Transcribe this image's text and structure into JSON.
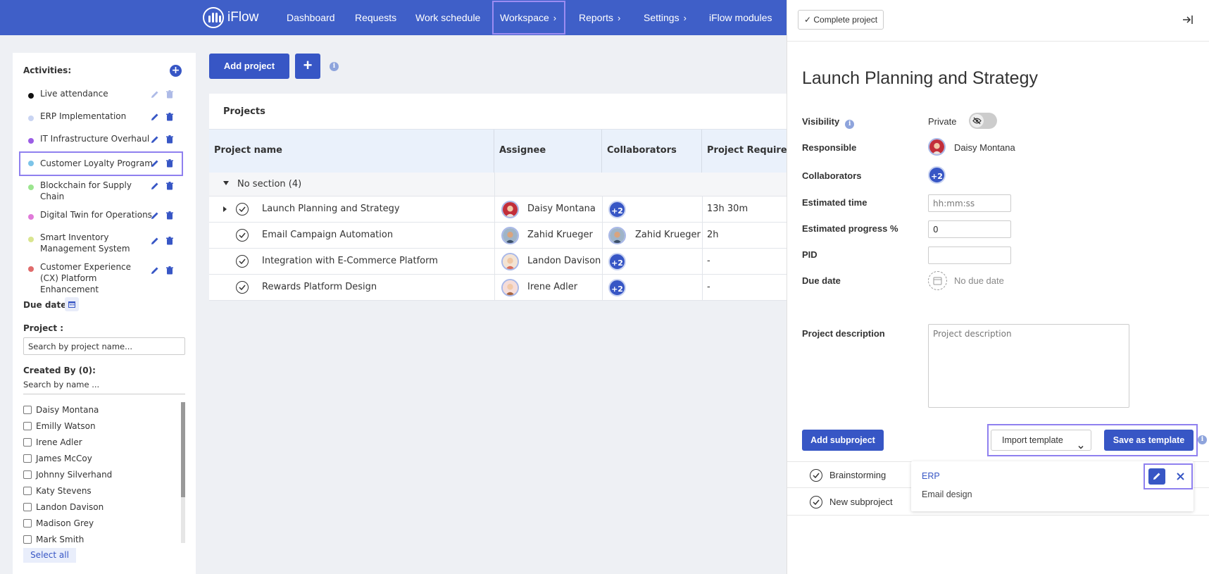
{
  "app": {
    "logo_text": "iFlow"
  },
  "nav": {
    "items": [
      {
        "label": "Dashboard"
      },
      {
        "label": "Requests"
      },
      {
        "label": "Work schedule"
      },
      {
        "label": "Workspace",
        "has_chevron": true,
        "active": true
      },
      {
        "label": "Reports",
        "has_chevron": true
      },
      {
        "label": "Settings",
        "has_chevron": true
      },
      {
        "label": "iFlow modules"
      }
    ]
  },
  "sidebar": {
    "activities_label": "Activities:",
    "activities": [
      {
        "name": "Live attendance",
        "color": "#111111",
        "disabled": true
      },
      {
        "name": "ERP Implementation",
        "color": "#c9d4f2"
      },
      {
        "name": "IT Infrastructure Overhaul",
        "color": "#9b5de5"
      },
      {
        "name": "Customer Loyalty Program",
        "color": "#7cc4e8",
        "selected": true
      },
      {
        "name": "Blockchain for Supply Chain",
        "color": "#9be58f"
      },
      {
        "name": "Digital Twin for Operations",
        "color": "#e07ad9"
      },
      {
        "name": "Smart Inventory Management System",
        "color": "#d9e58f"
      },
      {
        "name": "Customer Experience (CX) Platform Enhancement",
        "color": "#e06b6b"
      }
    ],
    "due_date_label": "Due date:",
    "project_label": "Project :",
    "project_placeholder": "Search by project name...",
    "created_by_label": "Created By (0):",
    "name_search_placeholder": "Search by name ...",
    "users": [
      "Daisy Montana",
      "Emilly Watson",
      "Irene Adler",
      "James McCoy",
      "Johnny Silverhand",
      "Katy Stevens",
      "Landon Davison",
      "Madison Grey",
      "Mark Smith"
    ],
    "select_all_label": "Select all"
  },
  "main": {
    "add_project_label": "Add project",
    "add_icon_label": "+",
    "info_label": "i",
    "panel_title": "Projects",
    "columns": [
      "Project name",
      "Assignee",
      "Collaborators",
      "Project Required"
    ],
    "section_label": "No section (4)",
    "rows": [
      {
        "name": "Launch Planning and Strategy",
        "assignee": "Daisy Montana",
        "collab_badge": "+2",
        "required": "13h 30m",
        "expandable": true
      },
      {
        "name": "Email Campaign Automation",
        "assignee": "Zahid Krueger",
        "collab_name": "Zahid Krueger",
        "required": "2h"
      },
      {
        "name": "Integration with E-Commerce Platform",
        "assignee": "Landon Davison",
        "collab_badge": "+2",
        "required": "-"
      },
      {
        "name": "Rewards Platform Design",
        "assignee": "Irene Adler",
        "collab_badge": "+2",
        "required": "-"
      }
    ]
  },
  "detail": {
    "complete_label": "Complete project",
    "title": "Launch Planning and Strategy",
    "visibility_label": "Visibility",
    "visibility_value": "Private",
    "responsible_label": "Responsible",
    "responsible_value": "Daisy Montana",
    "collaborators_label": "Collaborators",
    "collaborators_badge": "+2",
    "estimated_time_label": "Estimated time",
    "estimated_time_placeholder": "hh:mm:ss",
    "estimated_progress_label": "Estimated progress %",
    "estimated_progress_value": "0",
    "pid_label": "PID",
    "pid_value": "",
    "due_date_label": "Due date",
    "due_date_value": "No due date",
    "description_label": "Project description",
    "description_placeholder": "Project description",
    "add_subproject_label": "Add subproject",
    "import_template_label": "Import template",
    "save_template_label": "Save as template",
    "subprojects": [
      "Brainstorming",
      "New subproject"
    ],
    "template_options": [
      "ERP",
      "Email design"
    ]
  },
  "colors": {
    "primary": "#3756c5",
    "nav_bg": "#3f5fc8",
    "highlight": "#8f80ef"
  }
}
